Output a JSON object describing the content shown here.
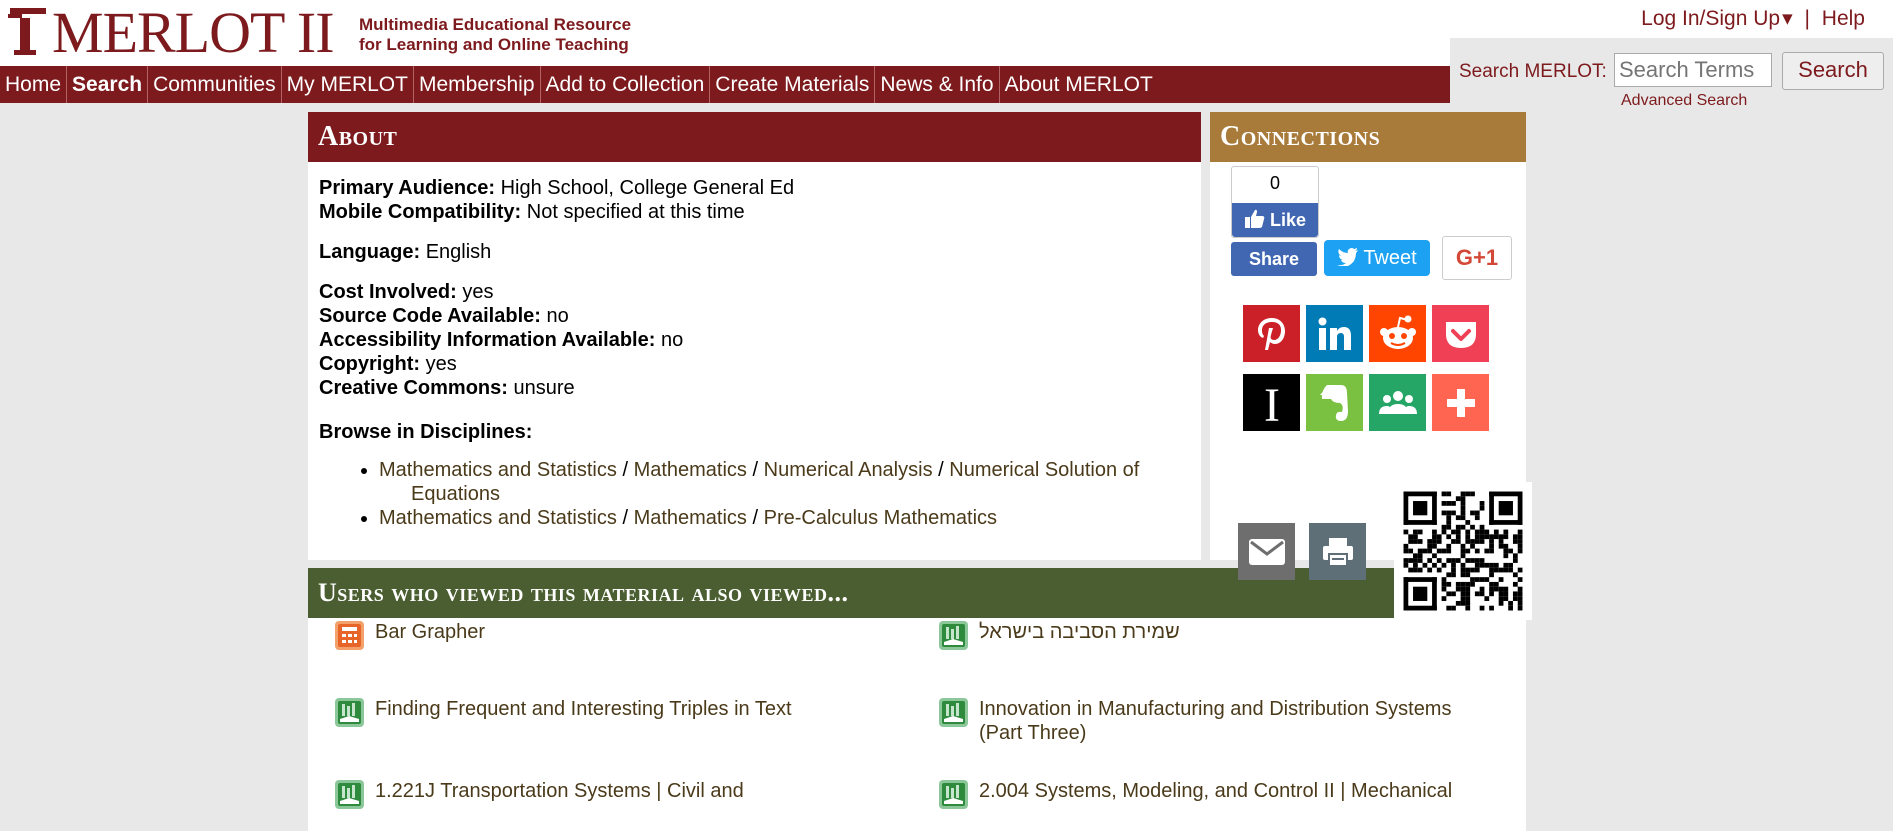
{
  "brand": {
    "name": "MERLOT II",
    "tagline_line1": "Multimedia Educational Resource",
    "tagline_line2": "for Learning and Online Teaching",
    "color": "#7d1a1d"
  },
  "header": {
    "login_label": "Log In/Sign Up",
    "login_caret": "▾",
    "separator": "|",
    "help_label": "Help"
  },
  "nav": {
    "items": [
      {
        "label": "Home"
      },
      {
        "label": "Search"
      },
      {
        "label": "Communities"
      },
      {
        "label": "My MERLOT"
      },
      {
        "label": "Membership"
      },
      {
        "label": "Add to Collection"
      },
      {
        "label": "Create Materials"
      },
      {
        "label": "News & Info"
      },
      {
        "label": "About MERLOT"
      }
    ],
    "active": "Search"
  },
  "search": {
    "label": "Search MERLOT:",
    "placeholder": "Search Terms",
    "button_label": "Search",
    "advanced_label": "Advanced Search"
  },
  "about": {
    "title": "About",
    "primary_audience_label": "Primary Audience:",
    "primary_audience_value": "High School, College General Ed",
    "mobile_label": "Mobile Compatibility:",
    "mobile_value": "Not specified at this time",
    "language_label": "Language:",
    "language_value": "English",
    "cost_label": "Cost Involved:",
    "cost_value": "yes",
    "source_label": "Source Code Available:",
    "source_value": "no",
    "access_label": "Accessibility Information Available:",
    "access_value": "no",
    "copyright_label": "Copyright:",
    "copyright_value": "yes",
    "cc_label": "Creative Commons:",
    "cc_value": "unsure",
    "browse_label": "Browse in Disciplines:",
    "disciplines": [
      {
        "links": [
          "Mathematics and Statistics",
          "Mathematics",
          "Numerical Analysis",
          "Numerical Solution of"
        ],
        "continuation": "Equations"
      },
      {
        "links": [
          "Mathematics and Statistics",
          "Mathematics",
          "Pre-Calculus Mathematics"
        ]
      }
    ],
    "path_separator": "/"
  },
  "connections": {
    "title": "Connections",
    "like_count": "0",
    "like_label": "Like",
    "share_label": "Share",
    "tweet_label": "Tweet",
    "gplus_label": "G+1",
    "share_services": [
      {
        "name": "pinterest-icon",
        "color": "#cb2027"
      },
      {
        "name": "linkedin-icon",
        "color": "#007bb5"
      },
      {
        "name": "reddit-icon",
        "color": "#ff4500"
      },
      {
        "name": "pocket-icon",
        "color": "#ef4056"
      },
      {
        "name": "instapaper-icon",
        "color": "#000000"
      },
      {
        "name": "evernote-icon",
        "color": "#7ac142"
      },
      {
        "name": "google-classroom-icon",
        "color": "#25a667"
      },
      {
        "name": "more-share-icon",
        "color": "#ff6550"
      }
    ]
  },
  "actions": {
    "email_icon": "email-icon",
    "print_icon": "print-icon"
  },
  "users_also_viewed": {
    "title": "Users who viewed this material also viewed...",
    "items": [
      {
        "title": "Bar Grapher",
        "icon": "calculator-icon",
        "color": "#e8652a"
      },
      {
        "title": "שמירת הסביבה בישראל",
        "icon": "reference-material-icon",
        "color": "#2e8b3e"
      },
      {
        "title": "Finding Frequent and Interesting Triples in Text",
        "icon": "reference-material-icon",
        "color": "#2e8b3e"
      },
      {
        "title": "Innovation in Manufacturing and Distribution Systems (Part Three)",
        "icon": "reference-material-icon",
        "color": "#2e8b3e"
      },
      {
        "title": "1.221J Transportation Systems | Civil and",
        "icon": "reference-material-icon",
        "color": "#2e8b3e"
      },
      {
        "title": "2.004 Systems, Modeling, and Control II | Mechanical",
        "icon": "reference-material-icon",
        "color": "#2e8b3e"
      }
    ]
  }
}
